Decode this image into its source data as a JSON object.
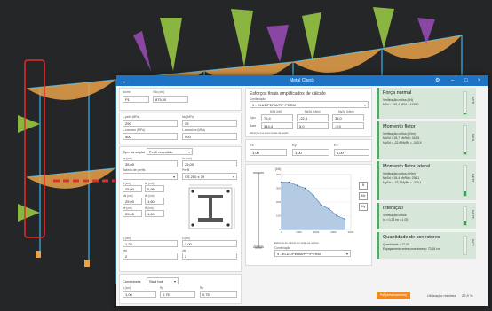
{
  "window": {
    "title": "Metal Check",
    "back_icon": "arrow-left-icon",
    "gear": "⚙",
    "minimize": "–",
    "maximize": "□",
    "close": "×"
  },
  "left": {
    "nome_label": "Nome",
    "nome_value": "P1",
    "vao_label": "Vão (cm)",
    "vao_value": "875,00",
    "fy_perfil_label": "fᵧ perfil (MPa)",
    "fy_perfil_value": "290",
    "fck_label": "fck (MPa)",
    "fck_value": "25",
    "fu_conector_label": "fᵤ conector (MPa)",
    "fu_conector_value": "500",
    "fy_armadura_label": "fᵧ armadura (MPa)",
    "fy_armadura_value": "500",
    "tipo_label": "Tipo da seção",
    "tipo_value": "Perfil revestido",
    "bc_label": "bc (cm)",
    "bc_value": "35,00",
    "hc_label": "hc (cm)",
    "hc_value": "25,00",
    "tabela_label": "Tabela de perfis",
    "perfil_label": "Perfil",
    "perfil_value": "CS 250 x 79",
    "d_label": "d (cm)",
    "d_value": "25,00",
    "tw_label": "tw (cm)",
    "tw_value": "0,95",
    "bfs_label": "bfs (cm)",
    "bfs_value": "25,00",
    "tfs_label": "tfs (cm)",
    "tfs_value": "1,60",
    "bfi_label": "bfi (cm)",
    "bfi_value": "25,00",
    "tfi_label": "tfi (cm)",
    "tfi_value": "1,60",
    "phi_label": "ϕ (cm)",
    "phi_value": "1,25",
    "c_label": "c (cm)",
    "c_value": "3,00",
    "nbx_label": "nbx",
    "nbx_value": "2",
    "nby_label": "nby",
    "nby_value": "2",
    "conectores_label": "Conectores",
    "conectores_value": "Stud bolt",
    "phi2_label": "ϕ (cm)",
    "phi2_value": "1,00",
    "rg_label": "Rg",
    "rg_value": "0,75",
    "rp_label": "Rp",
    "rp_value": "0,75"
  },
  "middle": {
    "header": "Esforços finais amplificados de cálculo",
    "comb_label": "Combinação",
    "comb_value": "9 - ELU1/PERM/PP+PERM",
    "cols": [
      "NSd (kN)",
      "MxSd (kNm)",
      "MySd (kNm)"
    ],
    "rows": [
      {
        "name": "Topo",
        "n": "76,4",
        "mx": "-22,5",
        "my": "35,0"
      },
      {
        "name": "Base",
        "n": "344,4",
        "mx": "5,0",
        "my": "-9,0"
      }
    ],
    "note": "Esforços nos eixos locais da seção",
    "kx_label": "Kx",
    "kx_value": "1,00",
    "ky_label": "Ky",
    "ky_value": "1,00",
    "kz_label": "Kz",
    "kz_value": "1,00",
    "chart_unit": "[kN]",
    "chart_caption": "Esforços de cálculo em todas as seções",
    "side_buttons": [
      "N",
      "Mx",
      "My"
    ],
    "comb2_label": "Combinação",
    "comb2_value": "9 - ELU1/PERM/PP+PERM"
  },
  "chart_data": {
    "type": "area",
    "x": [
      0,
      100,
      200,
      300,
      400,
      500,
      600,
      700,
      800
    ],
    "values": [
      344,
      344,
      320,
      300,
      250,
      180,
      150,
      100,
      76
    ],
    "xticks": [
      "0",
      "1000",
      "2000",
      "3000",
      "4000"
    ],
    "yticks": [
      "400",
      "300",
      "200",
      "100",
      "0"
    ],
    "xlim": [
      0,
      875
    ],
    "ylim": [
      0,
      400
    ]
  },
  "results": [
    {
      "title": "Força normal",
      "l1": "Verificação crítica (kN)",
      "l2": "NSd = 345,4  NRd = 4158,1",
      "pct": "8,3%",
      "fill": 0.083
    },
    {
      "title": "Momento fletor",
      "l1": "Verificação crítica (kNm)",
      "l2": "MxSd = 18,7  MxRd = 343,5",
      "l3": "MySd = -22,6  MyRd = -343,5",
      "pct": "6,6%",
      "fill": 0.066
    },
    {
      "title": "Momento fletor lateral",
      "l1": "Verificação crítica (kNm)",
      "l2": "MxSd = 26,4  MxRd = 236,1",
      "l3": "MySd = -23,2  MyRd = -236,1",
      "pct": "15,4%",
      "fill": 0.154
    },
    {
      "title": "Interação",
      "l1": "Verificação crítica",
      "l2": "Iv = 0,23  Im = 1,00",
      "pct": "22,9%",
      "fill": 0.229
    },
    {
      "title": "Quantidade de conectores",
      "l1": "Quantidade = 12,00",
      "l2": "Espaçamento entre conectores = 73,18 cm",
      "pct": "0,0%",
      "fill": 0.0
    }
  ],
  "footer": {
    "report_button": "Pdf (detalhamento)",
    "usage_label": "Utilização máxima",
    "usage_value": "22,9 %"
  },
  "colors": {
    "accent": "#1f73c4",
    "ok": "#5aa36a",
    "alert": "#e0302a",
    "orange": "#f08a1e"
  }
}
